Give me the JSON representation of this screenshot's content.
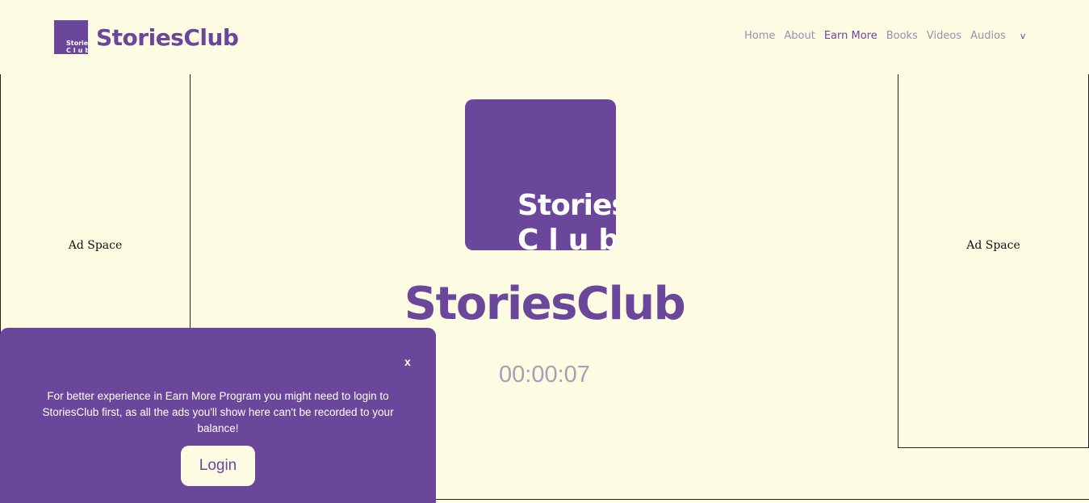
{
  "header": {
    "brand_name": "StoriesClub",
    "logo_line1": "Stories",
    "logo_line2": "Club",
    "nav": {
      "home": "Home",
      "about": "About",
      "earn_more": "Earn More",
      "books": "Books",
      "videos": "Videos",
      "audios": "Audios",
      "more": "v"
    },
    "active_nav": "Earn More"
  },
  "ads": {
    "left_label": "Ad Space",
    "right_label": "Ad Space"
  },
  "main": {
    "logo_line1": "Stories",
    "logo_line2": "Club",
    "title": "StoriesClub",
    "timer": "00:00:07"
  },
  "popup": {
    "close_label": "x",
    "message": "For better experience in Earn More Program you might need to login to StoriesClub first, as all the ads you'll show here can't be recorded to your balance!",
    "login_label": "Login"
  },
  "colors": {
    "brand": "#6b479b",
    "background": "#fdfbe1",
    "muted_text": "#9d8fae"
  }
}
